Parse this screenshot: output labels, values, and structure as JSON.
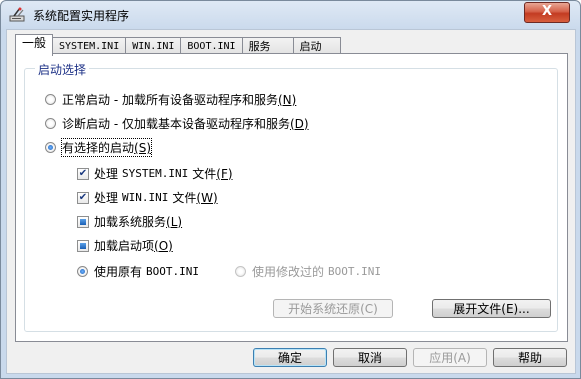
{
  "window": {
    "title": "系统配置实用程序",
    "close_label": "X"
  },
  "tabs": [
    "一般",
    "SYSTEM.INI",
    "WIN.INI",
    "BOOT.INI",
    "服务",
    "启动"
  ],
  "startup_group": {
    "title": "启动选择",
    "normal": {
      "text": "正常启动 - 加载所有设备驱动程序和服务",
      "key": "(N)",
      "selected": false
    },
    "diagnostic": {
      "text": "诊断启动 - 仅加载基本设备驱动程序和服务",
      "key": "(D)",
      "selected": false
    },
    "selective": {
      "text": "有选择的启动",
      "key": "(S)",
      "selected": true
    },
    "sub": {
      "system_ini": {
        "prefix": "处理 ",
        "name": "SYSTEM.INI",
        "suffix": " 文件",
        "key": "(F)",
        "state": "checked"
      },
      "win_ini": {
        "prefix": "处理 ",
        "name": "WIN.INI",
        "suffix": " 文件",
        "key": "(W)",
        "state": "checked"
      },
      "services": {
        "text": "加载系统服务",
        "key": "(L)",
        "state": "mixed"
      },
      "startup_items": {
        "text": "加载启动项",
        "key": "(O)",
        "state": "mixed"
      },
      "use_original": {
        "prefix": "使用原有 ",
        "name": "BOOT.INI",
        "selected": true
      },
      "use_modified": {
        "prefix": "使用修改过的 ",
        "name": "BOOT.INI",
        "selected": false,
        "disabled": true
      }
    },
    "restore_button": "开始系统还原(C)",
    "expand_button": "展开文件(E)..."
  },
  "footer": {
    "ok": "确定",
    "cancel": "取消",
    "apply": "应用(A)",
    "help": "帮助"
  },
  "check_glyph": "✔"
}
